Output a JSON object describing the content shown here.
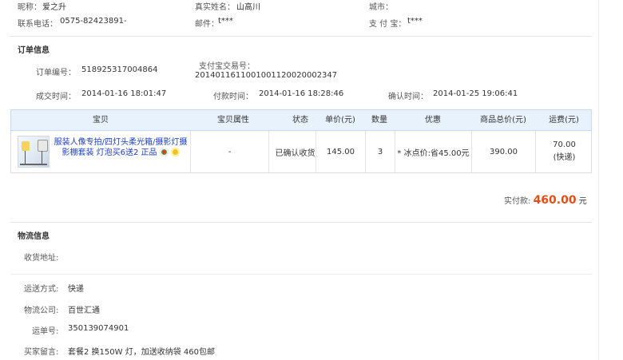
{
  "buyer": {
    "nickname_label": "昵称：",
    "nickname": "爱之升",
    "realname_label": "真实姓名：",
    "realname": "山高川",
    "city_label": "城市：",
    "city": "",
    "phone_label": "联系电话：",
    "phone": "0575-82423891-",
    "email_label": "邮件：",
    "email": "t***",
    "alipay_label": "支 付 宝：",
    "alipay": "t***"
  },
  "order": {
    "section_title": "订单信息",
    "order_no_label": "订单编号：",
    "order_no": "518925317004864",
    "trade_no_label": "支付宝交易号：",
    "trade_no": "2014011611001001120020002347",
    "deal_time_label": "成交时间：",
    "deal_time": "2014-01-16 18:01:47",
    "pay_time_label": "付款时间：",
    "pay_time": "2014-01-16 18:28:46",
    "confirm_time_label": "确认时间：",
    "confirm_time": "2014-01-25 19:06:41"
  },
  "table": {
    "headers": [
      "宝贝",
      "宝贝属性",
      "状态",
      "单价(元)",
      "数量",
      "优惠",
      "商品总价(元)",
      "运费(元)"
    ],
    "row": {
      "title": "服装人像专拍/四灯头柔光箱/摄影灯摄影棚套装 灯泡买6送2 正品",
      "attributes": "-",
      "status": "已确认收货",
      "price": "145.00",
      "quantity": "3",
      "discount": "* 冰点价:省45.00元",
      "total": "390.00",
      "shipping_fee": "70.00",
      "shipping_method": "(快递)"
    }
  },
  "payment": {
    "label": "实付款:",
    "amount": "460.00",
    "unit": "元"
  },
  "logistics": {
    "section_title": "物流信息",
    "address_label": "收货地址:",
    "address": "",
    "method_label": "运送方式:",
    "method": "快递",
    "company_label": "物流公司:",
    "company": "百世汇通",
    "waybill_label": "运单号:",
    "waybill": "350139074901",
    "message_label": "买家留言:",
    "message": "套餐2 换150W 灯，加送收纳袋 460包邮"
  },
  "colors": {
    "accent_price": "#e34f14",
    "link": "#1c3fbf",
    "table_header_bg": "#e8f2fd"
  }
}
